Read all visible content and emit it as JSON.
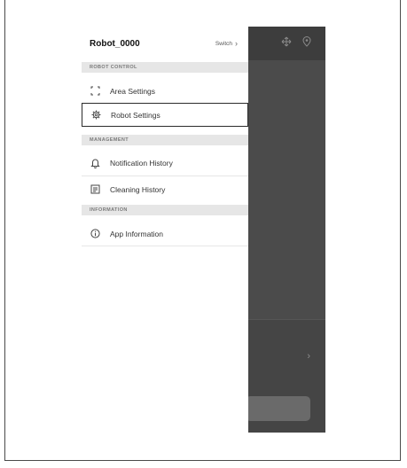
{
  "drawer": {
    "robot_name": "Robot_0000",
    "switch_label": "Switch",
    "sections": {
      "robot_control": "ROBOT CONTROL",
      "management": "MANAGEMENT",
      "information": "INFORMATION"
    },
    "items": {
      "area_settings": "Area Settings",
      "robot_settings": "Robot Settings",
      "notification_history": "Notification History",
      "cleaning_history": "Cleaning History",
      "app_information": "App Information"
    },
    "selected_item": "Robot Settings"
  },
  "icons": {
    "switch": "chevron-right-icon",
    "area_settings": "area-frame-icon",
    "robot_settings": "gear-icon",
    "notification_history": "bell-icon",
    "cleaning_history": "document-list-icon",
    "app_information": "info-icon",
    "app_top_right": [
      "move-arrows-icon",
      "location-pin-icon"
    ]
  },
  "colors": {
    "drawer_bg": "#ffffff",
    "section_header_bg": "#e6e6e6",
    "app_background": "#4b4b4b",
    "selected_outline": "#2b2b2b"
  }
}
